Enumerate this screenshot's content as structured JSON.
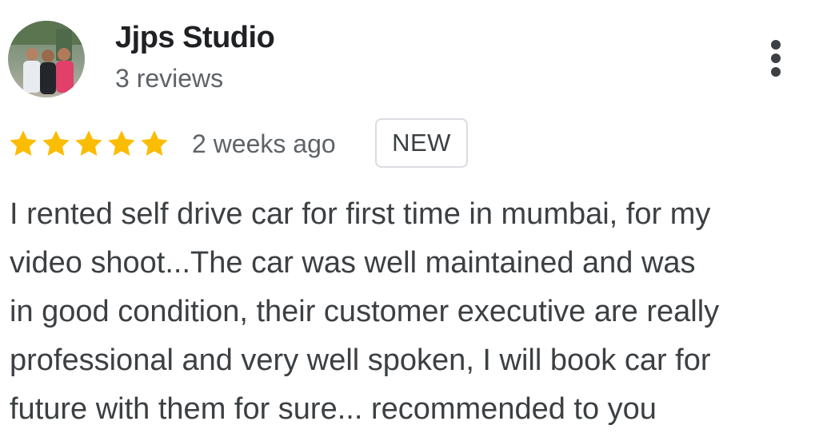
{
  "reviewer": {
    "name": "Jjps Studio",
    "review_count": "3 reviews",
    "avatar_icon": "profile-photo"
  },
  "menu": {
    "icon": "more-vert-icon"
  },
  "review": {
    "rating": 5,
    "rating_max": 5,
    "star_color": "#fbbc04",
    "time_ago": "2 weeks ago",
    "badge": "NEW",
    "text_lines": [
      "I rented self drive car for first time in mumbai, for my",
      "video shoot...The car was well maintained and was",
      "in good condition, their customer executive are really",
      "professional and very well spoken, I will book car for",
      "future with them for sure... recommended to you"
    ]
  }
}
